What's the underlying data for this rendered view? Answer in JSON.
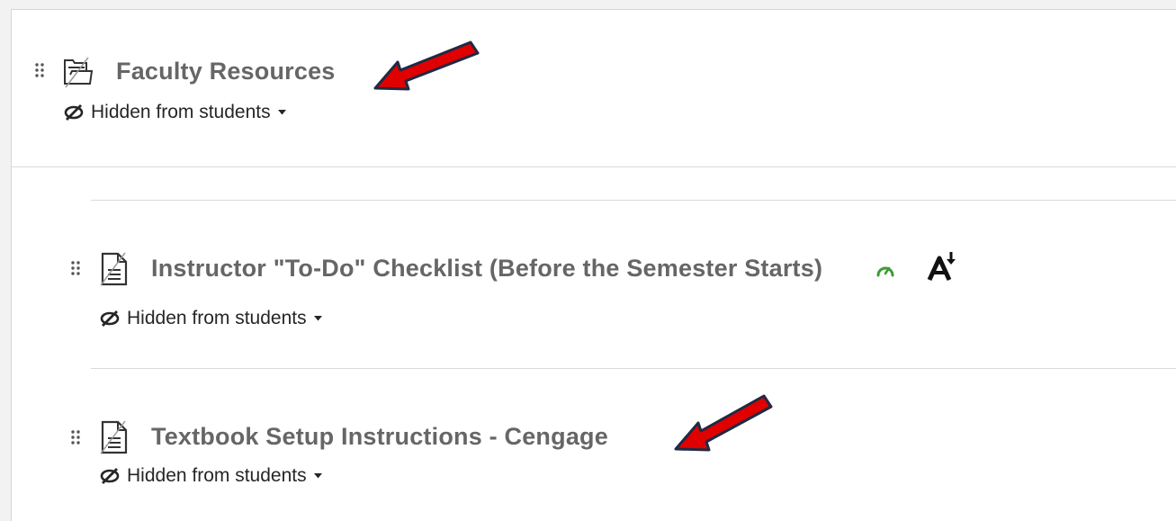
{
  "colors": {
    "title": "#666666",
    "text": "#262626",
    "divider": "#d9d9d9",
    "progress": "#3d9b35",
    "arrow_fill": "#e00000",
    "arrow_outline": "#1f2a44"
  },
  "items": [
    {
      "type_icon": "folder-icon",
      "title": "Faculty Resources",
      "visibility_label": "Hidden from students",
      "annotated": true
    },
    {
      "type_icon": "document-icon",
      "title": "Instructor \"To-Do\" Checklist (Before the Semester Starts)",
      "visibility_label": "Hidden from students",
      "status_icons": [
        "progress-gauge-icon",
        "accessibility-download-icon"
      ],
      "annotated": false
    },
    {
      "type_icon": "document-icon",
      "title": "Textbook Setup Instructions - Cengage",
      "visibility_label": "Hidden from students",
      "annotated": true
    }
  ]
}
